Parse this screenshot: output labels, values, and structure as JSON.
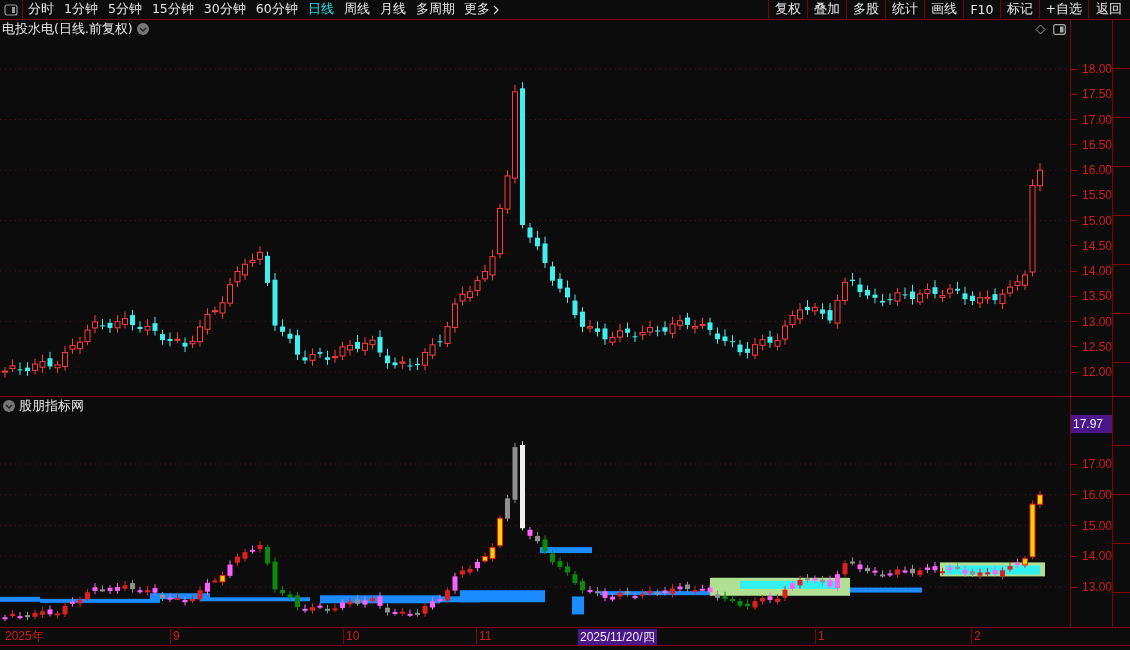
{
  "toolbar": {
    "tabs": [
      {
        "label": "分时",
        "selected": false
      },
      {
        "label": "1分钟",
        "selected": false
      },
      {
        "label": "5分钟",
        "selected": false
      },
      {
        "label": "15分钟",
        "selected": false
      },
      {
        "label": "30分钟",
        "selected": false
      },
      {
        "label": "60分钟",
        "selected": false
      },
      {
        "label": "日线",
        "selected": true
      },
      {
        "label": "周线",
        "selected": false
      },
      {
        "label": "月线",
        "selected": false
      },
      {
        "label": "多周期",
        "selected": false
      }
    ],
    "more": "更多",
    "buttons": [
      "复权",
      "叠加",
      "多股",
      "统计",
      "画线",
      "F10",
      "标记",
      "+自选",
      "返回"
    ]
  },
  "main_chart": {
    "title": "电投水电(日线.前复权)",
    "y_ticks": [
      "18.00",
      "17.50",
      "17.00",
      "16.50",
      "16.00",
      "15.50",
      "15.00",
      "14.50",
      "14.00",
      "13.50",
      "13.00",
      "12.50",
      "12.00"
    ]
  },
  "indicator": {
    "title": "股朋指标网",
    "price_tag": "17.97",
    "y_ticks": [
      "17.00",
      "16.00",
      "15.00",
      "14.00",
      "13.00"
    ]
  },
  "date_axis": {
    "labels": [
      {
        "text": "2025年",
        "kind": "year"
      },
      {
        "text": "9",
        "kind": "month"
      },
      {
        "text": "10",
        "kind": "month"
      },
      {
        "text": "11",
        "kind": "month"
      },
      {
        "text": "1",
        "kind": "month"
      },
      {
        "text": "2",
        "kind": "month"
      }
    ],
    "cursor_date": "2025/11/20/四"
  }
}
